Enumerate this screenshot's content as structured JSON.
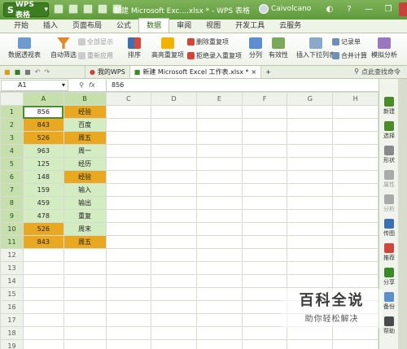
{
  "app": {
    "name": "WPS 表格",
    "window_title": "新建 Microsoft Exc....xlsx * - WPS 表格",
    "user": "Caivolcano"
  },
  "menu_tabs": [
    {
      "label": "开始",
      "active": false
    },
    {
      "label": "插入",
      "active": false
    },
    {
      "label": "页面布局",
      "active": false
    },
    {
      "label": "公式",
      "active": false
    },
    {
      "label": "数据",
      "active": true
    },
    {
      "label": "审阅",
      "active": false
    },
    {
      "label": "视图",
      "active": false
    },
    {
      "label": "开发工具",
      "active": false
    },
    {
      "label": "云服务",
      "active": false
    }
  ],
  "ribbon": {
    "pivot": "数据透视表",
    "autofilter": "自动筛选",
    "show_all": "全部显示",
    "reapply": "重新应用",
    "sort": "排序",
    "highlight_dup": "高亮重复项",
    "remove_dup": "删除重复项",
    "reject_dup": "拒绝录入重复项",
    "split": "分列",
    "validity": "有效性",
    "dropdown_list": "插入下拉列表",
    "record": "记录单",
    "merge_calc": "合并计算",
    "simulate": "模拟分析"
  },
  "doc_tabs": {
    "my_wps": "我的WPS",
    "file": "新建 Microsoft Excel 工作表.xlsx *",
    "new_tab": "+",
    "search": "点此查找命令"
  },
  "formula_bar": {
    "name_box": "A1",
    "fx": "fx",
    "value": "856"
  },
  "columns": [
    "A",
    "B",
    "C",
    "D",
    "E",
    "F",
    "G",
    "H"
  ],
  "rows": [
    {
      "n": "1",
      "a": "856",
      "b": "经验",
      "af": "cur",
      "bf": "o"
    },
    {
      "n": "2",
      "a": "843",
      "b": "百度",
      "af": "o",
      "bf": "g"
    },
    {
      "n": "3",
      "a": "526",
      "b": "周五",
      "af": "o",
      "bf": "o"
    },
    {
      "n": "4",
      "a": "963",
      "b": "周一",
      "af": "g",
      "bf": "g"
    },
    {
      "n": "5",
      "a": "125",
      "b": "经历",
      "af": "g",
      "bf": "g"
    },
    {
      "n": "6",
      "a": "148",
      "b": "经验",
      "af": "g",
      "bf": "o"
    },
    {
      "n": "7",
      "a": "159",
      "b": "输入",
      "af": "g",
      "bf": "g"
    },
    {
      "n": "8",
      "a": "459",
      "b": "输出",
      "af": "g",
      "bf": "g"
    },
    {
      "n": "9",
      "a": "478",
      "b": "重复",
      "af": "g",
      "bf": "g"
    },
    {
      "n": "10",
      "a": "526",
      "b": "周末",
      "af": "o",
      "bf": "g"
    },
    {
      "n": "11",
      "a": "843",
      "b": "周五",
      "af": "o",
      "bf": "o"
    },
    {
      "n": "12"
    },
    {
      "n": "13"
    },
    {
      "n": "14"
    },
    {
      "n": "15"
    },
    {
      "n": "16"
    },
    {
      "n": "17"
    },
    {
      "n": "18"
    },
    {
      "n": "19"
    }
  ],
  "side_panel": [
    "新建",
    "选择",
    "形状",
    "属性",
    "分析",
    "传图",
    "推荐",
    "分享",
    "备份",
    "帮助"
  ],
  "watermark": {
    "title": "百科全说",
    "subtitle": "助你轻松解决"
  },
  "colors": {
    "accent": "#5e9a3a",
    "dup_fill": "#e8a821",
    "sel_fill": "#d4ecc2"
  }
}
